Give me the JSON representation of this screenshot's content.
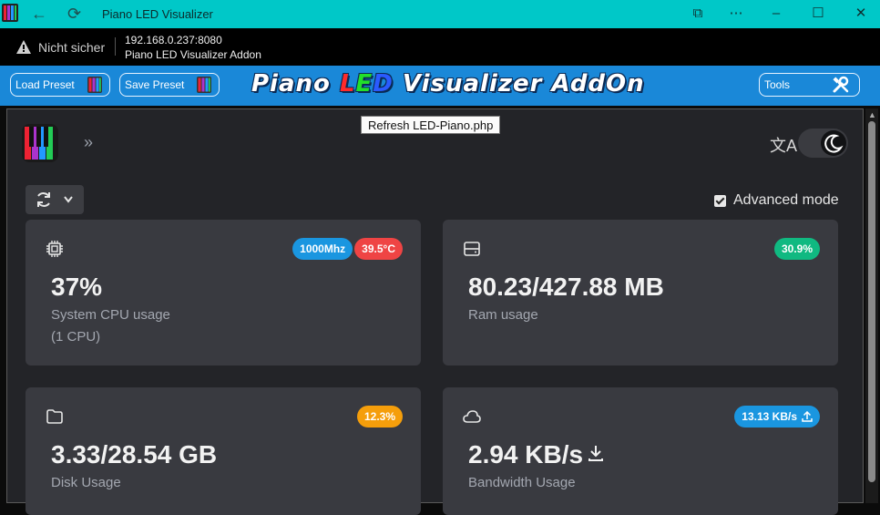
{
  "window": {
    "title": "Piano LED Visualizer"
  },
  "addressbar": {
    "security": "Nicht sicher",
    "url": "192.168.0.237:8080",
    "page_title": "Piano LED Visualizer Addon"
  },
  "header": {
    "load_preset": "Load Preset",
    "save_preset": "Save Preset",
    "brand": {
      "part1": "Piano ",
      "l": "L",
      "e": "E",
      "d": "D",
      "part2": " Visualizer AddOn"
    },
    "tools": "Tools"
  },
  "tooltip": "Refresh LED-Piano.php",
  "toolbar": {
    "advanced_mode": "Advanced mode",
    "advanced_checked": true
  },
  "cards": {
    "cpu": {
      "freq_badge": "1000Mhz",
      "temp_badge": "39.5°C",
      "value": "37%",
      "label": "System CPU usage",
      "sublabel": "(1 CPU)"
    },
    "ram": {
      "badge": "30.9%",
      "value": "80.23/427.88 MB",
      "label": "Ram usage"
    },
    "disk": {
      "badge": "12.3%",
      "value": "3.33/28.54 GB",
      "label": "Disk Usage"
    },
    "net": {
      "badge": "13.13 KB/s",
      "value": "2.94 KB/s",
      "label": "Bandwidth Usage"
    }
  },
  "colors": {
    "titlebar": "#00c8c8",
    "header": "#1a88d8",
    "badge_blue": "#1a96e0",
    "badge_red": "#ef4444",
    "badge_green": "#10b981",
    "badge_orange": "#f59e0b"
  }
}
